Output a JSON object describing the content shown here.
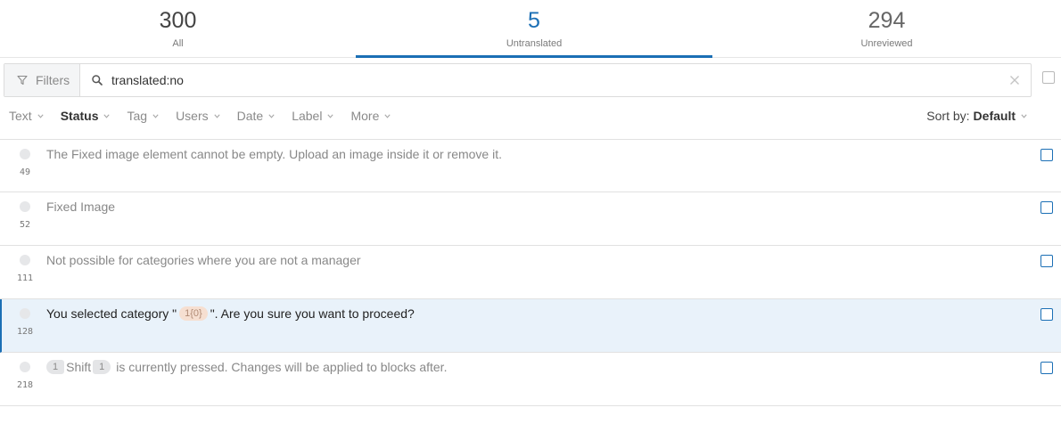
{
  "stats": [
    {
      "count": "300",
      "label": "All"
    },
    {
      "count": "5",
      "label": "Untranslated"
    },
    {
      "count": "294",
      "label": "Unreviewed"
    }
  ],
  "search": {
    "filters_label": "Filters",
    "query": "translated:no"
  },
  "filters": [
    {
      "label": "Text"
    },
    {
      "label": "Status"
    },
    {
      "label": "Tag"
    },
    {
      "label": "Users"
    },
    {
      "label": "Date"
    },
    {
      "label": "Label"
    },
    {
      "label": "More"
    }
  ],
  "sort": {
    "prefix": "Sort by:",
    "value": "Default"
  },
  "rows": [
    {
      "id": "49",
      "text": "The Fixed image element cannot be empty. Upload an image inside it or remove it."
    },
    {
      "id": "52",
      "text": "Fixed Image"
    },
    {
      "id": "111",
      "text": "Not possible for categories where you are not a manager"
    },
    {
      "id": "128",
      "text_before": "You selected category \"",
      "placeholder": "1{0}",
      "text_after": "\". Are you sure you want to proceed?"
    },
    {
      "id": "218",
      "tag_left": "1",
      "tag_word": "Shift",
      "tag_right": "1",
      "text_after": "is currently pressed. Changes will be applied to blocks after."
    }
  ],
  "colors": {
    "accent": "#1b6fb5",
    "selected_row_bg": "#e9f2fa",
    "placeholder_bg": "#f6dfd1"
  },
  "icons": [
    "funnel-icon",
    "search-icon",
    "close-icon",
    "chevron-down-icon",
    "status-dot-icon",
    "checkbox-icon"
  ]
}
